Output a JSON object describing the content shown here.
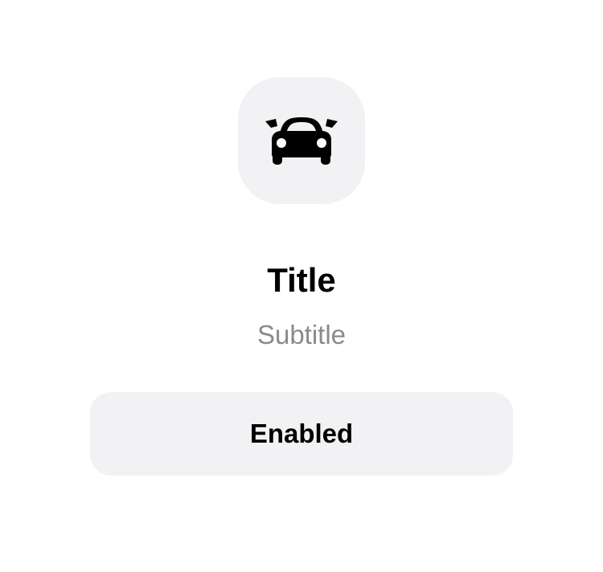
{
  "icon": {
    "name": "car-icon",
    "tile_color": "#f2f2f4",
    "glyph_color": "#000000"
  },
  "header": {
    "title": "Title",
    "subtitle": "Subtitle"
  },
  "button": {
    "label": "Enabled",
    "state": "enabled",
    "background": "#f2f2f4"
  },
  "colors": {
    "background": "#ffffff",
    "title": "#000000",
    "subtitle": "#8a8a8e"
  }
}
